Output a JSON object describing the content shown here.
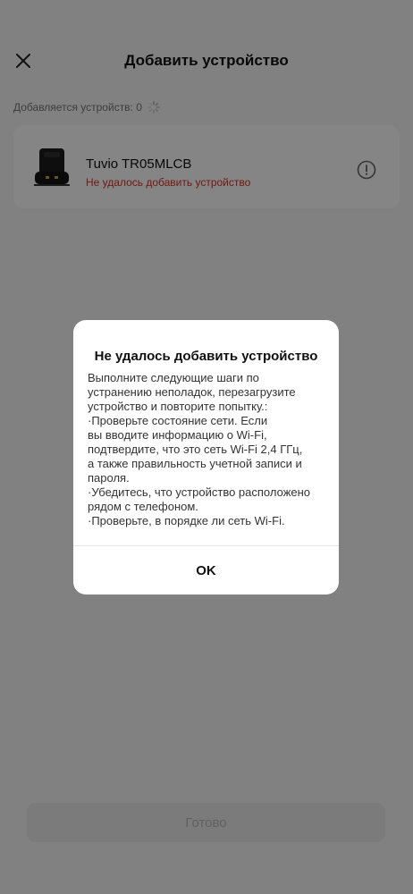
{
  "header": {
    "title": "Добавить устройство",
    "close_icon": "close-icon"
  },
  "status": {
    "text": "Добавляется устройств: 0",
    "icon": "spinner-icon"
  },
  "device": {
    "name": "Tuvio TR05MLCB",
    "error": "Не удалось добавить устройство",
    "info_icon": "exclamation-circle-icon",
    "image": "robot-vacuum-dock-image"
  },
  "done_button": {
    "label": "Готово"
  },
  "dialog": {
    "title": "Не удалось добавить устройство",
    "lines": [
      "Выполните следующие шаги по",
      "устранению неполадок, перезагрузите",
      "устройство и повторите попытку.:",
      "·Проверьте состояние сети. Если",
      "вы вводите информацию о Wi-Fi,",
      "подтвердите, что это сеть Wi-Fi 2,4 ГГц,",
      "а также правильность учетной записи и",
      "пароля.",
      "·Убедитесь, что устройство расположено",
      "рядом с телефоном.",
      "·Проверьте, в порядке ли сеть Wi-Fi."
    ],
    "ok_label": "OK"
  },
  "colors": {
    "error": "#d93025",
    "background": "#f7f7f7",
    "card": "#ffffff"
  }
}
